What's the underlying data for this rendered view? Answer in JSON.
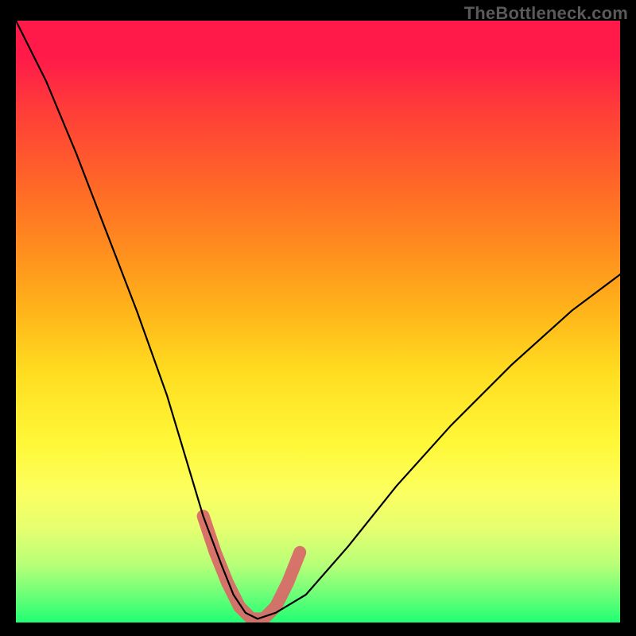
{
  "watermark": {
    "text": "TheBottleneck.com"
  },
  "chart_data": {
    "type": "line",
    "title": "",
    "xlabel": "",
    "ylabel": "",
    "xlim": [
      0,
      100
    ],
    "ylim": [
      0,
      100
    ],
    "grid": false,
    "legend": false,
    "background_gradient": {
      "direction": "top-to-bottom",
      "stops": [
        {
          "pos": 0.0,
          "color": "#ff1a4a"
        },
        {
          "pos": 0.3,
          "color": "#ff8e1e"
        },
        {
          "pos": 0.6,
          "color": "#ffdc20"
        },
        {
          "pos": 0.85,
          "color": "#e6ff70"
        },
        {
          "pos": 1.0,
          "color": "#1aff72"
        }
      ],
      "semantics": "red = severe bottleneck, green = balanced"
    },
    "series": [
      {
        "name": "bottleneck-curve",
        "style": "black-thin",
        "x": [
          0,
          5,
          10,
          15,
          20,
          25,
          28,
          31,
          34,
          36,
          38,
          40,
          43,
          48,
          55,
          63,
          72,
          82,
          92,
          100
        ],
        "y": [
          100,
          90,
          78,
          65,
          52,
          38,
          28,
          18,
          10,
          5,
          2,
          1,
          2,
          5,
          13,
          23,
          33,
          43,
          52,
          58
        ]
      },
      {
        "name": "optimal-range-highlight",
        "style": "pink-thick",
        "x": [
          31,
          33,
          35,
          37,
          39,
          41,
          43,
          45,
          47
        ],
        "y": [
          18,
          12,
          7,
          3,
          1,
          1,
          3,
          7,
          12
        ]
      }
    ],
    "annotations": []
  }
}
